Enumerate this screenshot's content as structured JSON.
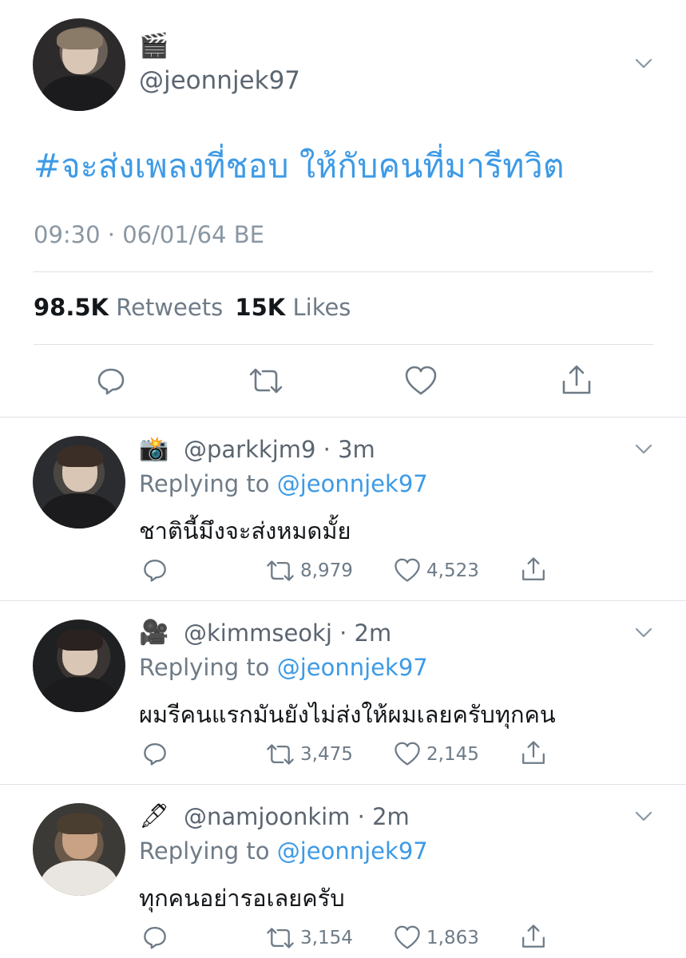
{
  "main": {
    "avatar_icon": "profile-photo",
    "handle_emoji": "🎬",
    "handle": "@jeonnjek97",
    "hashtag": "#จะส่งเพลงที่ชอบ ให้กับคนที่มารีทวิต",
    "timestamp": "09:30 · 06/01/64 BE",
    "retweet_count": "98.5K",
    "retweet_label": "Retweets",
    "like_count": "15K",
    "like_label": "Likes",
    "accent": "#3d9ae6"
  },
  "replies": [
    {
      "emoji": "📸",
      "handle_line": "@parkkjm9 · 3m",
      "replying_prefix": "Replying to ",
      "replying_to": "@jeonnjek97",
      "text": "ชาตินี้มึงจะส่งหมดมั้ย",
      "retweets": "8,979",
      "likes": "4,523"
    },
    {
      "emoji": "🎥",
      "handle_line": "@kimmseokj · 2m",
      "replying_prefix": "Replying to ",
      "replying_to": "@jeonnjek97",
      "text": "ผมรีคนแรกมันยังไม่ส่งให้ผมเลยครับทุกคน",
      "retweets": "3,475",
      "likes": "2,145"
    },
    {
      "emoji": "🖋",
      "handle_line": "@namjoonkim · 2m",
      "replying_prefix": "Replying to ",
      "replying_to": "@jeonnjek97",
      "text": "ทุกคนอย่ารอเลยครับ",
      "retweets": "3,154",
      "likes": "1,863"
    }
  ]
}
